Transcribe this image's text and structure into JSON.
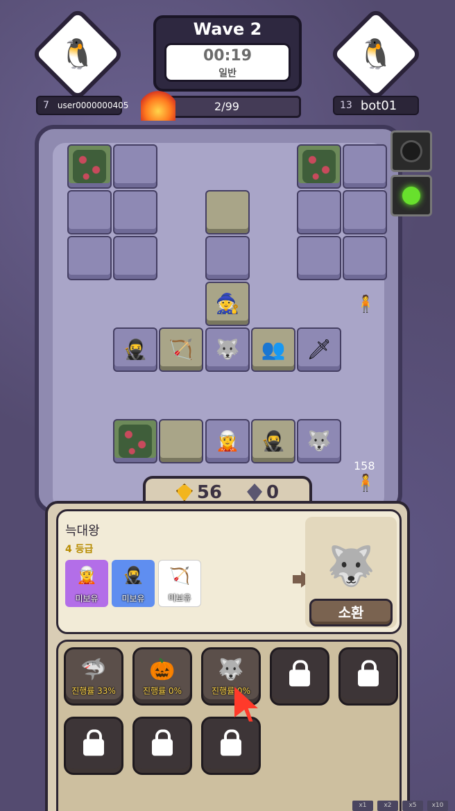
{
  "header": {
    "wave_label": "Wave 2",
    "timer": "00:19",
    "mode": "일반",
    "enemy_progress": "2/99"
  },
  "player_left": {
    "level": "7",
    "name": "user0000000405",
    "avatar_icon": "penguin-avatar-icon"
  },
  "player_right": {
    "level": "13",
    "name": "bot01",
    "avatar_icon": "penguin-avatar-icon"
  },
  "enemy_hp": "158",
  "resources": {
    "gold": "56",
    "gems": "0"
  },
  "recipe": {
    "unit_name": "늑대왕",
    "grade": "4 등급",
    "requirements": [
      {
        "label": "미보유",
        "color": "#b36ee8"
      },
      {
        "label": "미보유",
        "color": "#5f8ef0"
      },
      {
        "label": "미보유",
        "color": "#ffffff"
      }
    ],
    "summon_label": "소환"
  },
  "slots": [
    {
      "progress": "진행률 33%"
    },
    {
      "progress": "진행률 0%"
    },
    {
      "progress": "진행률 0%"
    }
  ],
  "speed_buttons": [
    "x1",
    "x2",
    "x5",
    "x10"
  ]
}
